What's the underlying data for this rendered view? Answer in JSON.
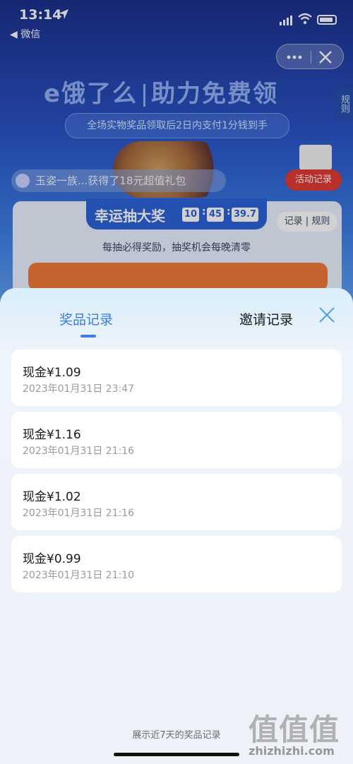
{
  "status_bar": {
    "time": "13:14",
    "back_label": "◀ 微信"
  },
  "capsule": {
    "more_glyph": "•••"
  },
  "header": {
    "brand": "e饿了么",
    "brand_slogan": "助力免费领",
    "subtitle": "全场实物奖品领取后2日内支付1分钱到手",
    "rules_side": "规则",
    "ticker": "玉姿一族...获得了18元超值礼包",
    "activity_button": "活动记录"
  },
  "draw": {
    "title": "幸运抽大奖",
    "countdown": {
      "h": "10",
      "m": "45",
      "s": "39.7"
    },
    "record_rules": "记录 | 规则",
    "desc": "每抽必得奖励，抽奖机会每晚清零"
  },
  "sheet": {
    "tabs": [
      {
        "label": "奖品记录",
        "active": true
      },
      {
        "label": "邀请记录",
        "active": false
      }
    ],
    "records": [
      {
        "amount": "现金¥1.09",
        "time": "2023年01月31日  23:47"
      },
      {
        "amount": "现金¥1.16",
        "time": "2023年01月31日  21:16"
      },
      {
        "amount": "现金¥1.02",
        "time": "2023年01月31日  21:16"
      },
      {
        "amount": "现金¥0.99",
        "time": "2023年01月31日  21:10"
      }
    ],
    "footer": "展示近7天的奖品记录"
  },
  "watermark": {
    "glyphs": "值值值",
    "domain": "zhizhizhi.com"
  },
  "colors": {
    "accent": "#3f7ee0",
    "danger": "#e03b36",
    "sheet_bg": "#eef2f8"
  }
}
